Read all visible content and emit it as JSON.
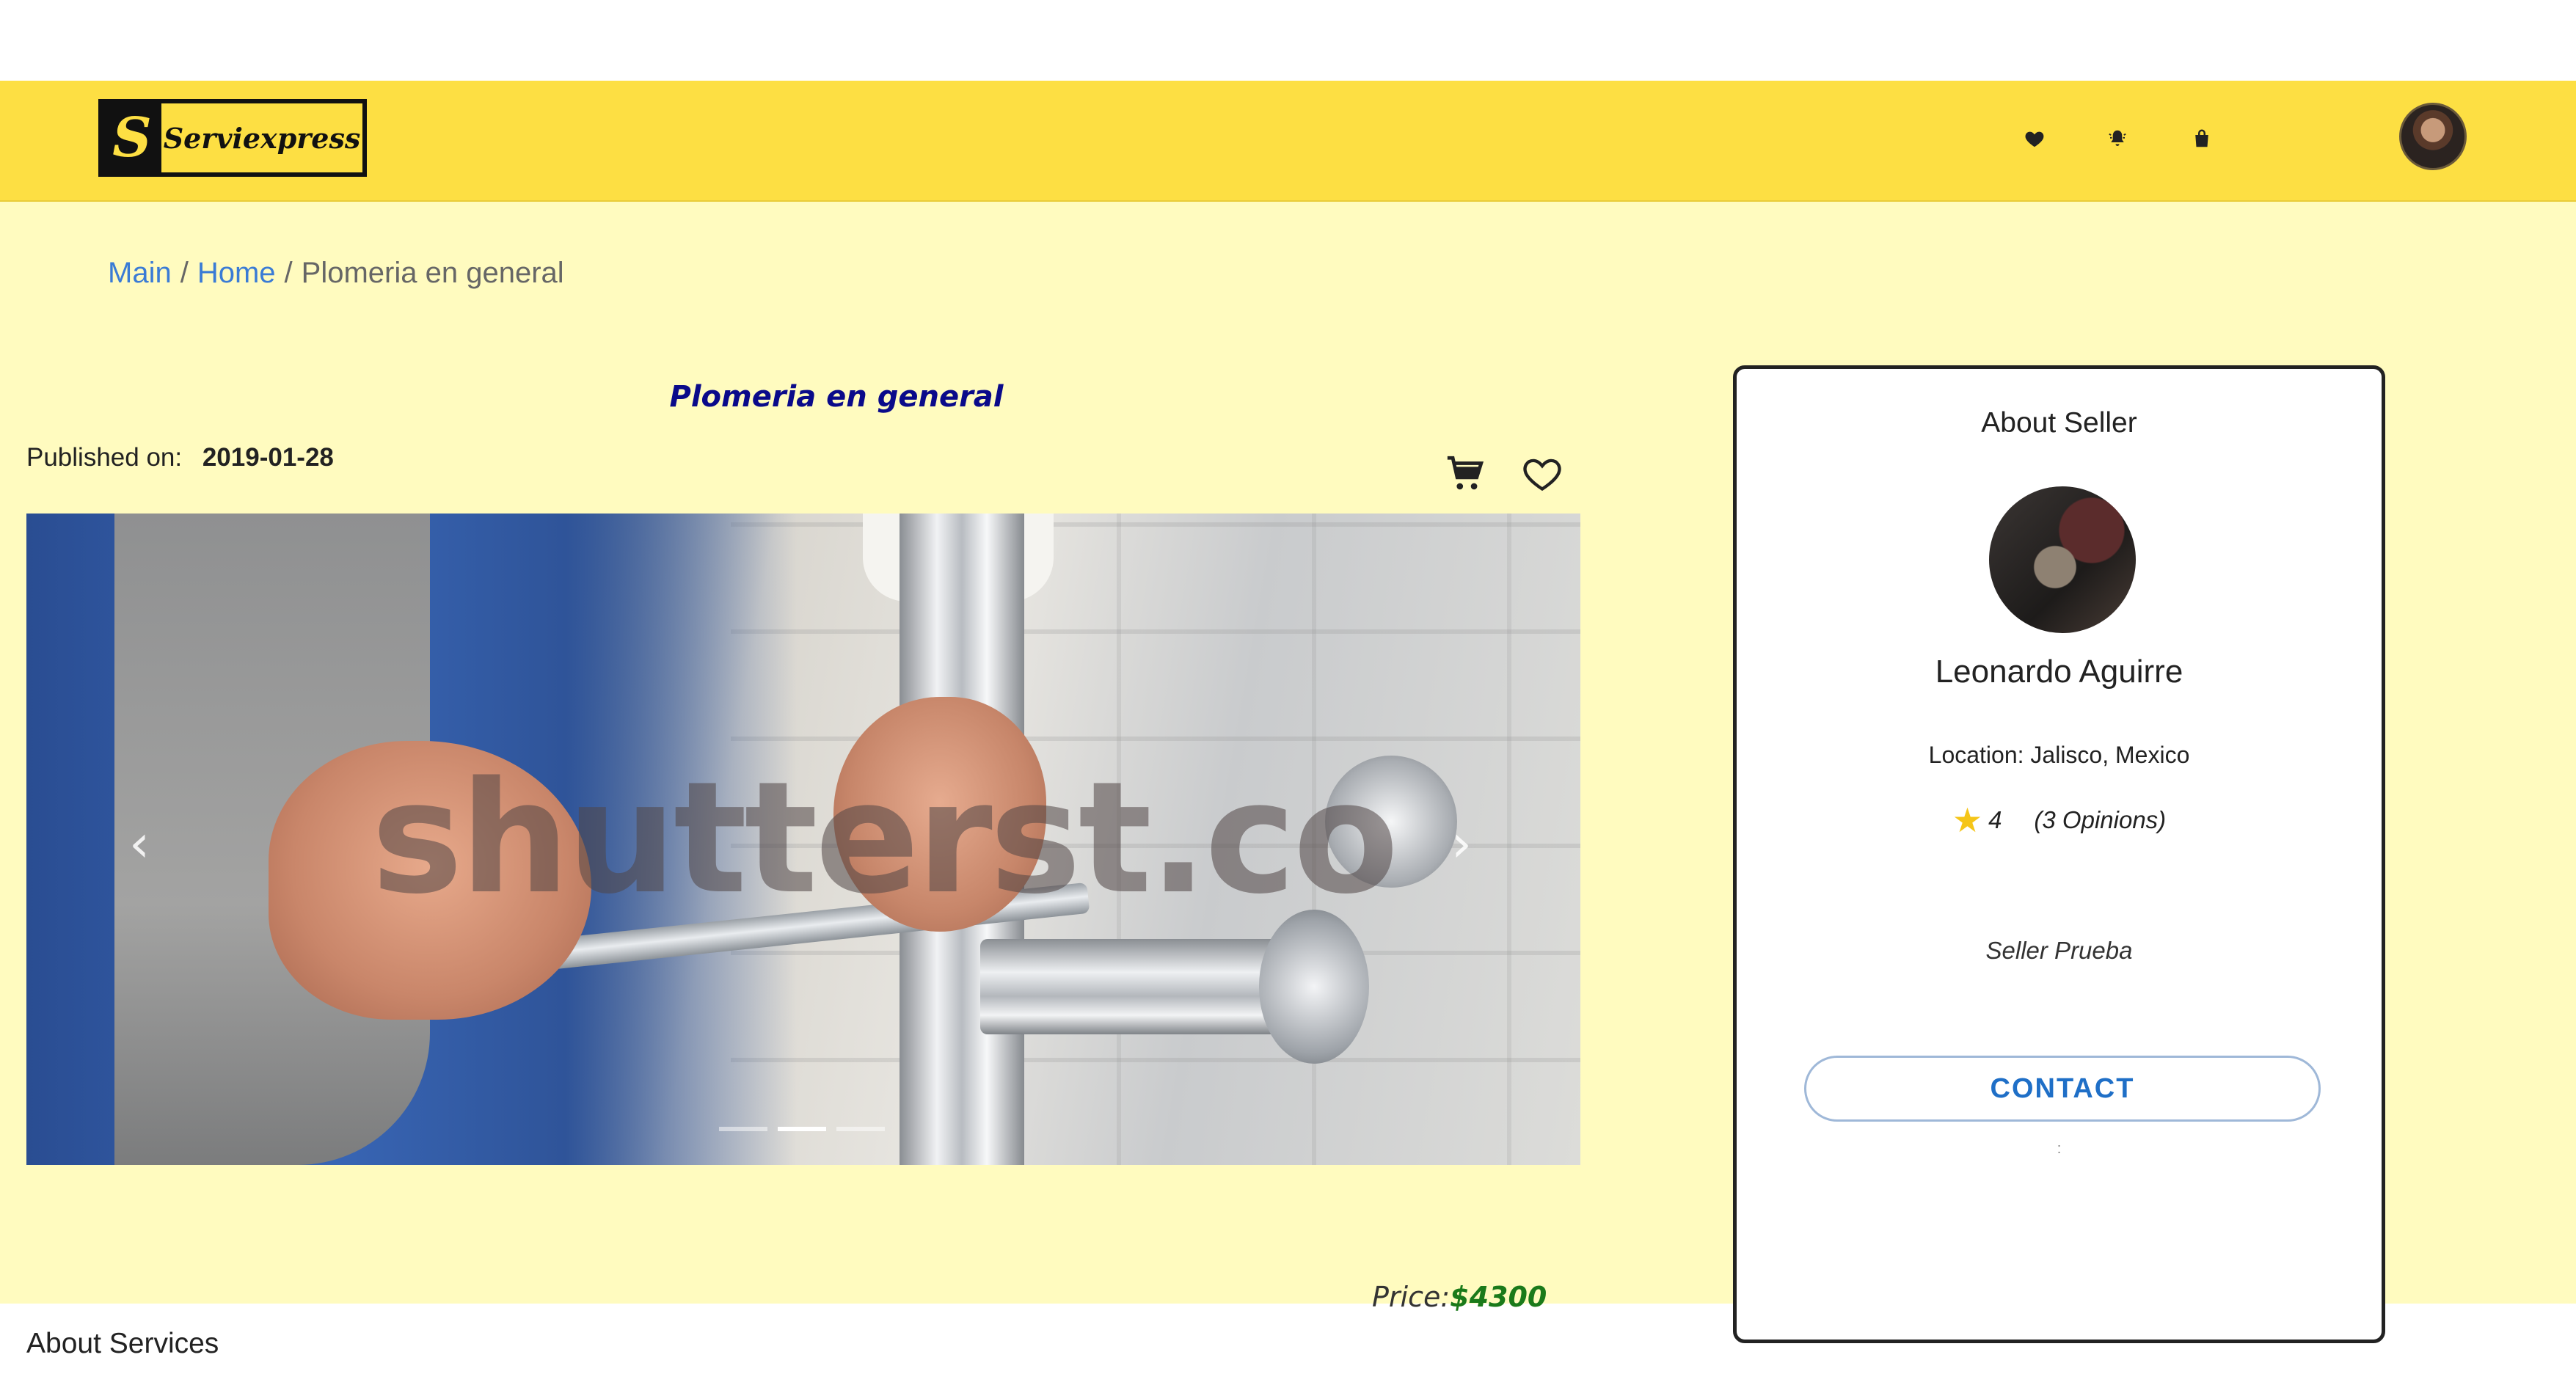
{
  "header": {
    "logo_mark": "S",
    "logo_text": "Serviexpress",
    "icons": [
      "heart-icon",
      "bell-icon",
      "bag-icon"
    ]
  },
  "breadcrumb": {
    "items": [
      "Main",
      "Home",
      "Plomeria en general"
    ],
    "separator": "/"
  },
  "service": {
    "title": "Plomeria en general",
    "published_label": "Published on:",
    "published_date": "2019-01-28",
    "price_label": "Price:",
    "price_value": "$4300",
    "about_label": "About Services",
    "image_watermark": "shutterst.co"
  },
  "carousel": {
    "prev_glyph": "‹",
    "next_glyph": "›",
    "slides_count": 3,
    "active_slide": 2
  },
  "seller": {
    "heading": "About Seller",
    "name": "Leonardo Aguirre",
    "location": "Location: Jalisco, Mexico",
    "rating": "4",
    "opinions": "(3 Opinions)",
    "description": "Seller Prueba",
    "contact_label": "CONTACT",
    "tiny_mark": ":"
  },
  "colors": {
    "header_bg": "#fddf43",
    "page_bg": "#fffbbf",
    "link": "#3a7bd5",
    "title": "#0a0a8a",
    "price": "#1a7a1a",
    "contact": "#1f6fc7"
  }
}
